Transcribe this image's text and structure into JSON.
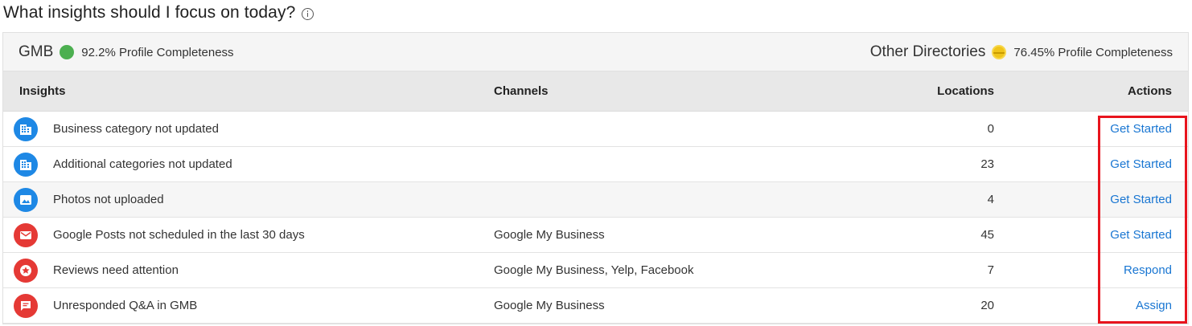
{
  "title": "What insights should I focus on today?",
  "summary": {
    "left": {
      "name": "GMB",
      "status_color": "#4caf50",
      "completeness": "92.2% Profile Completeness"
    },
    "right": {
      "name": "Other Directories",
      "status_color": "#f0c419",
      "completeness": "76.45% Profile Completeness"
    }
  },
  "columns": {
    "insights": "Insights",
    "channels": "Channels",
    "locations": "Locations",
    "actions": "Actions"
  },
  "rows": [
    {
      "icon": "building-icon",
      "icon_color": "#1e88e5",
      "insight": "Business category not updated",
      "channels": "",
      "locations": "0",
      "action": "Get Started"
    },
    {
      "icon": "building-icon",
      "icon_color": "#1e88e5",
      "insight": "Additional categories not updated",
      "channels": "",
      "locations": "23",
      "action": "Get Started"
    },
    {
      "icon": "photo-icon",
      "icon_color": "#1e88e5",
      "insight": "Photos not uploaded",
      "channels": "",
      "locations": "4",
      "action": "Get Started"
    },
    {
      "icon": "mail-icon",
      "icon_color": "#e53935",
      "insight": "Google Posts not scheduled in the last 30 days",
      "channels": "Google My Business",
      "locations": "45",
      "action": "Get Started"
    },
    {
      "icon": "star-icon",
      "icon_color": "#e53935",
      "insight": "Reviews need attention",
      "channels": "Google My Business, Yelp, Facebook",
      "locations": "7",
      "action": "Respond"
    },
    {
      "icon": "chat-icon",
      "icon_color": "#e53935",
      "insight": "Unresponded Q&A in GMB",
      "channels": "Google My Business",
      "locations": "20",
      "action": "Assign"
    }
  ],
  "highlight_color": "#e8141d"
}
